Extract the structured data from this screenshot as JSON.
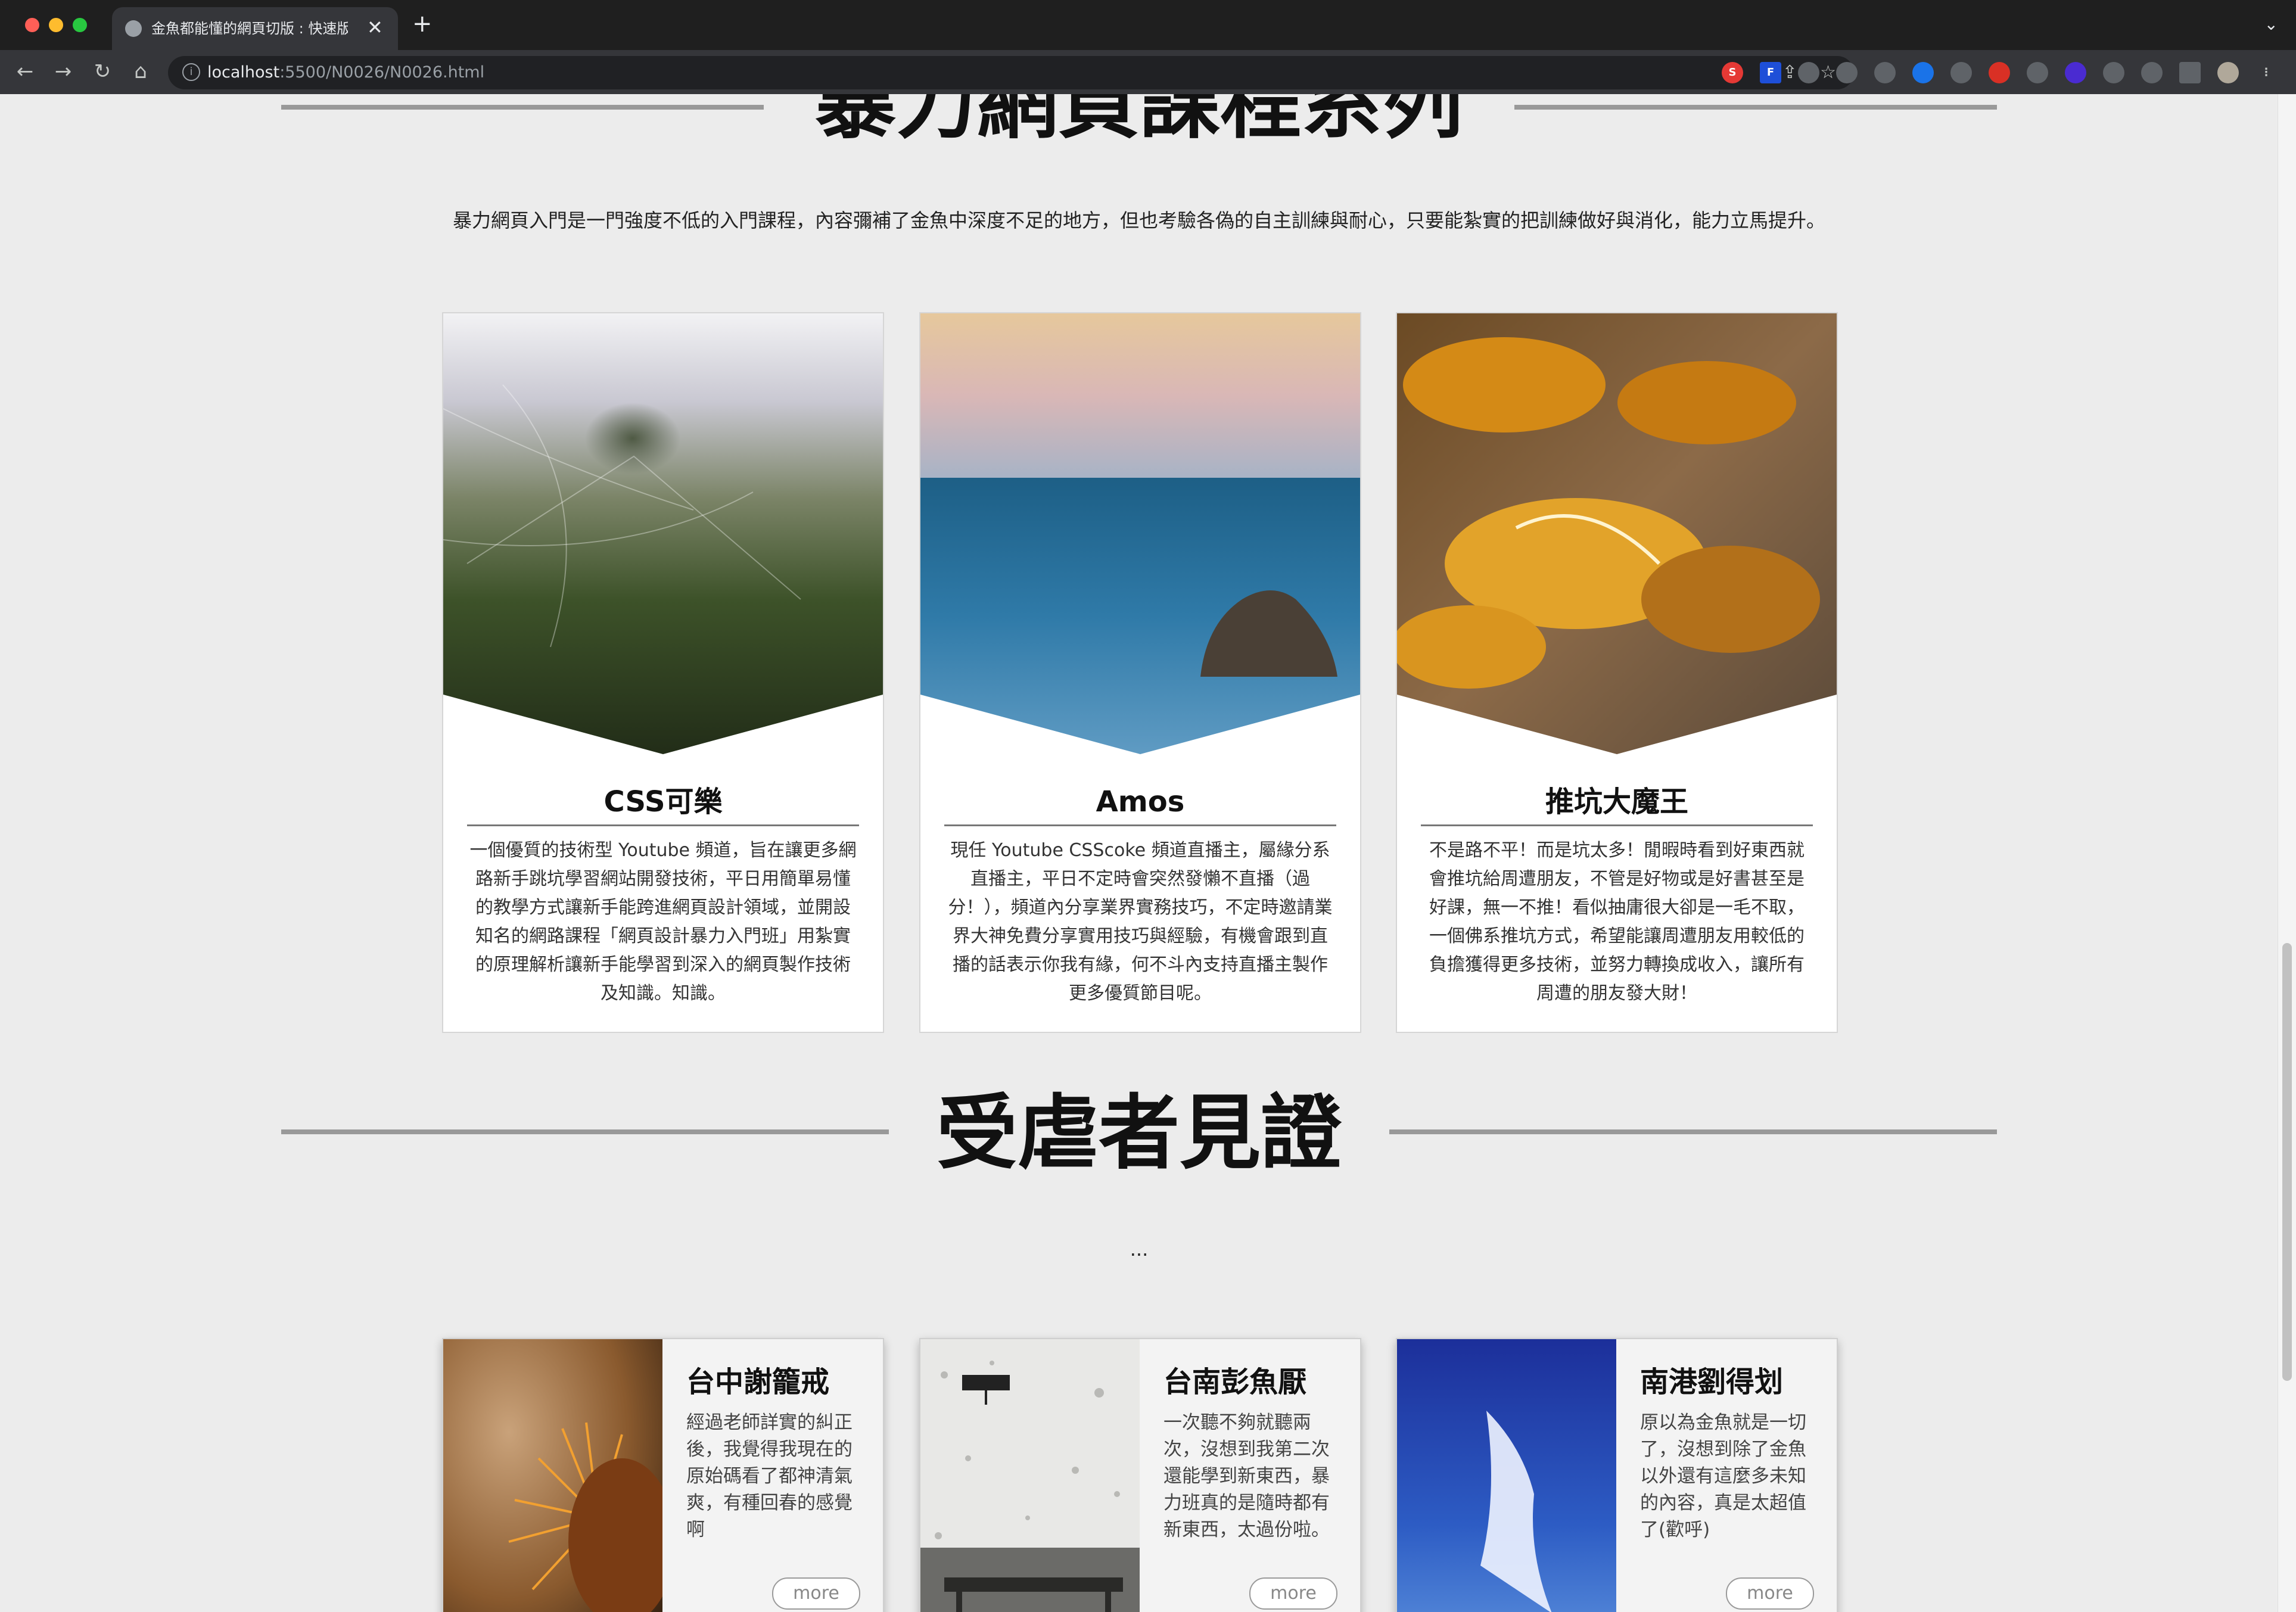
{
  "browser": {
    "tab_title": "金魚都能懂的網頁切版 : 快速版面",
    "tab_close": "✕",
    "new_tab": "+",
    "url_host": "localhost",
    "url_path": ":5500/N0026/N0026.html"
  },
  "courses": {
    "title": "暴力網頁課程系列",
    "intro": "暴力網頁入門是一門強度不低的入門課程，內容彌補了金魚中深度不足的地方，但也考驗各偽的自主訓練與耐心，只要能紮實的把訓練做好與消化，能力立馬提升。",
    "cards": [
      {
        "name": "CSS可樂",
        "desc": "一個優質的技術型 Youtube 頻道，旨在讓更多網路新手跳坑學習網站開發技術，平日用簡單易懂的教學方式讓新手能跨進網頁設計領域，並開設知名的網路課程「網頁設計暴力入門班」用紮實的原理解析讓新手能學習到深入的網頁製作技術及知識。知識。",
        "image": "foggy-field-spiderweb-photo"
      },
      {
        "name": "Amos",
        "desc": "現任 Youtube CSScoke 頻道直播主，屬緣分系直播主，平日不定時會突然發懶不直播（過分！），頻道內分享業界實務技巧，不定時邀請業界大神免費分享實用技巧與經驗，有機會跟到直播的話表示你我有緣，何不斗內支持直播主製作更多優質節目呢。",
        "image": "sea-rock-photo"
      },
      {
        "name": "推坑大魔王",
        "desc": "不是路不平！而是坑太多！閒暇時看到好東西就會推坑給周遭朋友，不管是好物或是好書甚至是好課，無一不推！看似抽庸很大卻是一毛不取，一個佛系推坑方式，希望能讓周遭朋友用較低的負擔獲得更多技術，並努力轉換成收入，讓所有周遭的朋友發大財！",
        "image": "autumn-leaves-photo"
      }
    ]
  },
  "testimonials": {
    "title": "受虐者見證",
    "subtitle": "...",
    "more_label": "more",
    "cards": [
      {
        "name": "台中謝籠戒",
        "text": "經過老師詳實的糾正後，我覺得我現在的原始碼看了都神清氣爽，有種回春的感覺啊",
        "image": "chestnut-burr-photo"
      },
      {
        "name": "台南彭魚厭",
        "text": "一次聽不夠就聽兩次，沒想到我第二次還能學到新東西，暴力班真的是隨時都有新東西，太過份啦。",
        "image": "white-wall-bench-photo"
      },
      {
        "name": "南港劉得划",
        "text": "原以為金魚就是一切了，沒想到除了金魚以外還有這麼多未知的內容，真是太超值了(歡呼)",
        "image": "blue-sky-cloud-photo"
      }
    ]
  }
}
